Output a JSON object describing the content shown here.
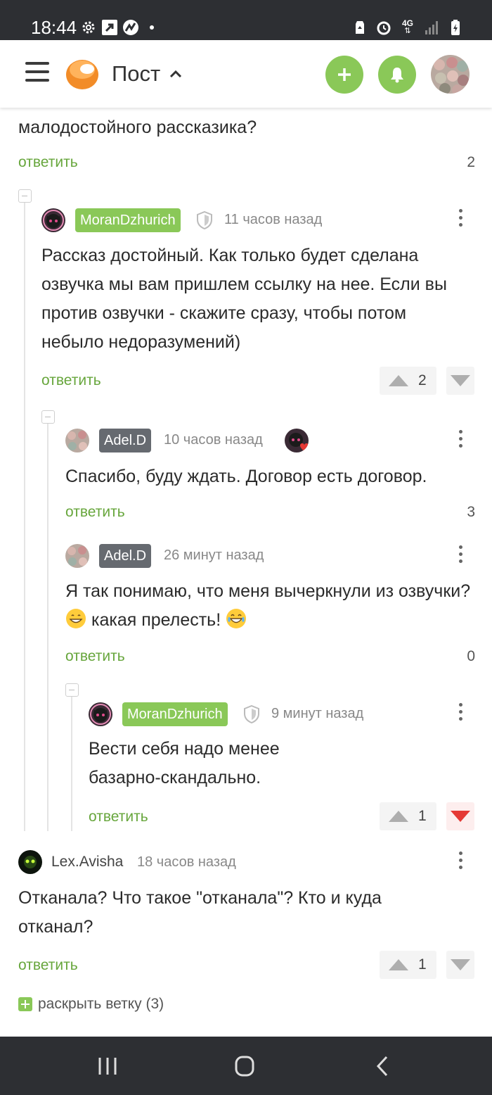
{
  "status_bar": {
    "time": "18:44",
    "icons_left": [
      "gear-icon",
      "arrow-up-right-icon",
      "app-logo-icon",
      "dot-icon"
    ],
    "icons_right": [
      "recycle-icon",
      "alarm-icon",
      "4g-icon",
      "signal-icon",
      "battery-charging-icon"
    ],
    "network": "4G"
  },
  "app_bar": {
    "title": "Пост",
    "accent": "#8ac858",
    "icons": [
      "menu-icon",
      "app-logo",
      "chevron-up-icon",
      "plus-icon",
      "bell-icon",
      "avatar"
    ]
  },
  "top_comment_tail": {
    "text": "малодостойного рассказика?",
    "reply_label": "ответить",
    "count": "2"
  },
  "comments": [
    {
      "author": "MoranDzhurich",
      "author_badge": "green",
      "time": "11 часов назад",
      "text": "Рассказ достойный. Как только будет сделана озвучка мы вам пришлем ссылку на нее. Если вы против озвучки - скажите сразу, чтобы потом небыло недоразумений)",
      "reply_label": "ответить",
      "rating": "2"
    },
    {
      "author": "Adel.D",
      "author_badge": "gray",
      "time": "10 часов назад",
      "text": "Спасибо, буду ждать. Договор есть договор.",
      "reply_label": "ответить",
      "count": "3"
    },
    {
      "author": "Adel.D",
      "author_badge": "gray",
      "time": "26 минут назад",
      "text_part1": "Я так понимаю, что меня вычеркнули из озвучки?",
      "text_part2": "какая прелесть!",
      "emojis": [
        "grinning-face-icon",
        "tears-of-joy-icon"
      ],
      "reply_label": "ответить",
      "count": "0"
    },
    {
      "author": "MoranDzhurich",
      "author_badge": "green",
      "time": "9 минут назад",
      "text": "Вести себя надо менее базарно-скандально.",
      "reply_label": "ответить",
      "rating": "1",
      "downvoted": true
    },
    {
      "author": "Lex.Avisha",
      "time": "18 часов назад",
      "text": "Отканала? Что такое \"отканала\"? Кто и куда отканал?",
      "reply_label": "ответить",
      "rating": "1"
    }
  ],
  "expand_thread": {
    "label": "раскрыть ветку (3)"
  },
  "nav_bar": {
    "buttons": [
      "recent-apps-icon",
      "home-icon",
      "back-icon"
    ]
  }
}
